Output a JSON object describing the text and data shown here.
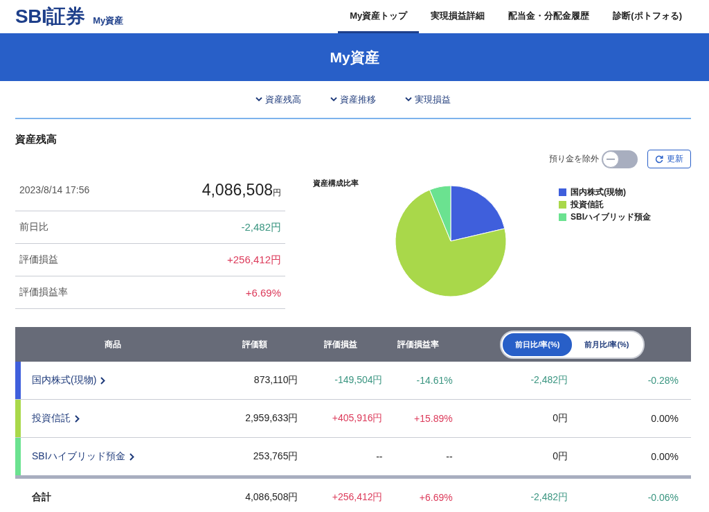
{
  "header": {
    "logo": "SBI証券",
    "subtitle": "My資産",
    "nav": [
      {
        "label": "My資産トップ",
        "selected": true
      },
      {
        "label": "実現損益詳細",
        "selected": false
      },
      {
        "label": "配当金・分配金履歴",
        "selected": false
      },
      {
        "label": "診断(ポトフォる)",
        "selected": false
      }
    ]
  },
  "banner": {
    "title": "My資産"
  },
  "anchors": [
    {
      "label": "資産残高"
    },
    {
      "label": "資産推移"
    },
    {
      "label": "実現損益"
    }
  ],
  "section": {
    "title": "資産残高"
  },
  "toggle": {
    "label": "預り金を除外",
    "on": false
  },
  "refresh": {
    "label": "更新"
  },
  "summary": {
    "date": "2023/8/14 17:56",
    "total": "4,086,508",
    "unit": "円",
    "rows": [
      {
        "label": "前日比",
        "value": "-2,482円",
        "color": "#3a9580"
      },
      {
        "label": "評価損益",
        "value": "+256,412円",
        "color": "#dc3a5a"
      },
      {
        "label": "評価損益率",
        "value": "+6.69%",
        "color": "#dc3a5a"
      }
    ]
  },
  "pie": {
    "title": "資産構成比率",
    "chart_data": {
      "type": "pie",
      "categories": [
        "国内株式(現物)",
        "投資信託",
        "SBIハイブリッド預金"
      ],
      "values": [
        21.36,
        72.43,
        6.21
      ],
      "colors": [
        "#3f5fdc",
        "#a9d84a",
        "#6be290"
      ]
    }
  },
  "table": {
    "columns": [
      "商品",
      "評価額",
      "評価損益",
      "評価損益率"
    ],
    "switch": [
      {
        "label": "前日比/率(%)",
        "selected": true
      },
      {
        "label": "前月比/率(%)",
        "selected": false
      }
    ],
    "rows": [
      {
        "color": "#3f5fdc",
        "cells": [
          {
            "text": "国内株式(現物)",
            "kind": "link"
          },
          {
            "text": "873,110円",
            "color": "#222222"
          },
          {
            "text": "-149,504円",
            "color": "#3a9580"
          },
          {
            "text": "-14.61%",
            "color": "#3a9580"
          },
          {
            "text": "-2,482円",
            "color": "#3a9580"
          },
          {
            "text": "-0.28%",
            "color": "#3a9580"
          }
        ]
      },
      {
        "color": "#a9d84a",
        "cells": [
          {
            "text": "投資信託",
            "kind": "link"
          },
          {
            "text": "2,959,633円",
            "color": "#222222"
          },
          {
            "text": "+405,916円",
            "color": "#dc3a5a"
          },
          {
            "text": "+15.89%",
            "color": "#dc3a5a"
          },
          {
            "text": "0円",
            "color": "#222222"
          },
          {
            "text": "0.00%",
            "color": "#222222"
          }
        ]
      },
      {
        "color": "#6be290",
        "cells": [
          {
            "text": "SBIハイブリッド預金",
            "kind": "link"
          },
          {
            "text": "253,765円",
            "color": "#222222"
          },
          {
            "text": "--",
            "color": "#222222"
          },
          {
            "text": "--",
            "color": "#222222"
          },
          {
            "text": "0円",
            "color": "#222222"
          },
          {
            "text": "0.00%",
            "color": "#222222"
          }
        ]
      }
    ],
    "total": {
      "cells": [
        {
          "text": "合計",
          "kind": "label"
        },
        {
          "text": "4,086,508円",
          "color": "#222222"
        },
        {
          "text": "+256,412円",
          "color": "#dc3a5a"
        },
        {
          "text": "+6.69%",
          "color": "#dc3a5a"
        },
        {
          "text": "-2,482円",
          "color": "#3a9580"
        },
        {
          "text": "-0.06%",
          "color": "#3a9580"
        }
      ]
    }
  }
}
